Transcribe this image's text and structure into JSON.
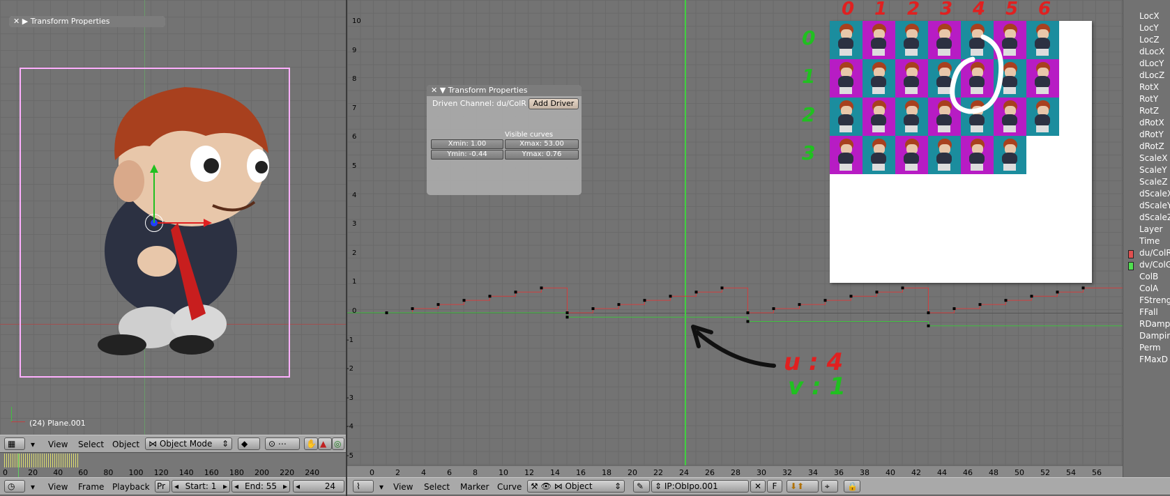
{
  "view3d": {
    "panel_title": "Transform Properties",
    "object_label": "(24) Plane.001",
    "header": {
      "view": "View",
      "select": "Select",
      "object": "Object",
      "mode": "Object Mode"
    }
  },
  "ipo": {
    "panel_title": "Transform Properties",
    "driven_channel": "Driven Channel: du/ColR",
    "add_driver": "Add Driver",
    "visible_curves": "Visible curves",
    "xmin": "Xmin: 1.00",
    "xmax": "Xmax: 53.00",
    "ymin": "Ymin: -0.44",
    "ymax": "Ymax: 0.76",
    "header": {
      "view": "View",
      "select": "Select",
      "marker": "Marker",
      "curve": "Curve",
      "object": "Object",
      "ipo_name": "IP:ObIpo.001",
      "f": "F"
    },
    "y_ticks": [
      "10",
      "9",
      "8",
      "7",
      "6",
      "5",
      "4",
      "3",
      "2",
      "1",
      "0",
      "-1",
      "-2",
      "-3",
      "-4",
      "-5"
    ],
    "x_ticks": [
      "0",
      "2",
      "4",
      "6",
      "8",
      "10",
      "12",
      "14",
      "16",
      "18",
      "20",
      "22",
      "24",
      "26",
      "28",
      "30",
      "32",
      "34",
      "36",
      "38",
      "40",
      "42",
      "44",
      "46",
      "48",
      "50",
      "52",
      "54",
      "56"
    ]
  },
  "channels": [
    "LocX",
    "LocY",
    "LocZ",
    "dLocX",
    "dLocY",
    "dLocZ",
    "RotX",
    "RotY",
    "RotZ",
    "dRotX",
    "dRotY",
    "dRotZ",
    "ScaleX",
    "ScaleY",
    "ScaleZ",
    "dScaleX",
    "dScaleY",
    "dScaleZ",
    "Layer",
    "Time",
    "du/ColR",
    "dv/ColG",
    "ColB",
    "ColA",
    "FStreng",
    "FFall",
    "RDamp",
    "Damping",
    "Perm",
    "FMaxD"
  ],
  "channel_colors": {
    "du/ColR": "#e05050",
    "dv/ColG": "#50e050"
  },
  "timeline": {
    "ticks": [
      "0",
      "20",
      "40",
      "60",
      "80",
      "100",
      "120",
      "140",
      "160",
      "180",
      "200",
      "220",
      "240"
    ],
    "header": {
      "view": "View",
      "frame": "Frame",
      "playback": "Playback",
      "pr": "Pr",
      "start": "Start: 1",
      "end": "End: 55",
      "current": "24"
    }
  },
  "annotations": {
    "col_nums": [
      "0",
      "1",
      "2",
      "3",
      "4",
      "5",
      "6"
    ],
    "row_nums": [
      "0",
      "1",
      "2",
      "3"
    ],
    "u": "u : 4",
    "v": "v : 1"
  },
  "colors": {
    "magenta": "#b71cc4",
    "teal": "#1b8d9e",
    "red_curve": "#d04040",
    "green_curve": "#40c040",
    "selection": "#ffb0ff"
  }
}
